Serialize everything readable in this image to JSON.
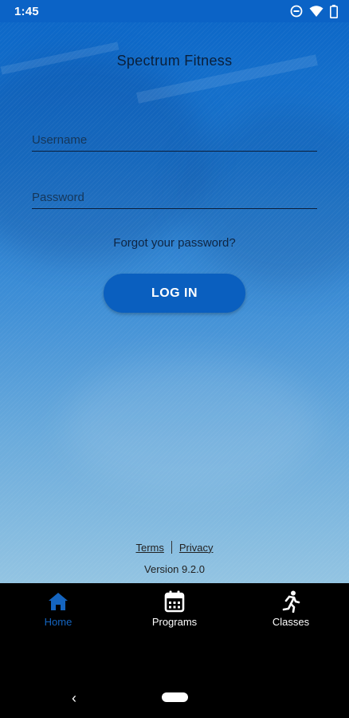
{
  "status_bar": {
    "time": "1:45",
    "icons": [
      "do-not-disturb-icon",
      "wifi-icon",
      "battery-icon"
    ]
  },
  "app": {
    "title": "Spectrum Fitness"
  },
  "login_form": {
    "username_placeholder": "Username",
    "username_value": "",
    "password_placeholder": "Password",
    "password_value": "",
    "forgot_label": "Forgot your password?",
    "login_label": "LOG IN"
  },
  "footer": {
    "terms_label": "Terms",
    "privacy_label": "Privacy",
    "version": "Version 9.2.0"
  },
  "tabs": [
    {
      "label": "Home",
      "icon": "home-icon",
      "active": true
    },
    {
      "label": "Programs",
      "icon": "calendar-icon",
      "active": false
    },
    {
      "label": "Classes",
      "icon": "running-person-icon",
      "active": false
    }
  ],
  "system_nav": {
    "back_icon": "‹"
  },
  "colors": {
    "accent": "#1565c0",
    "button": "#0a5fbf",
    "background_top": "#0d68c8",
    "background_bottom": "#93c4e2"
  }
}
